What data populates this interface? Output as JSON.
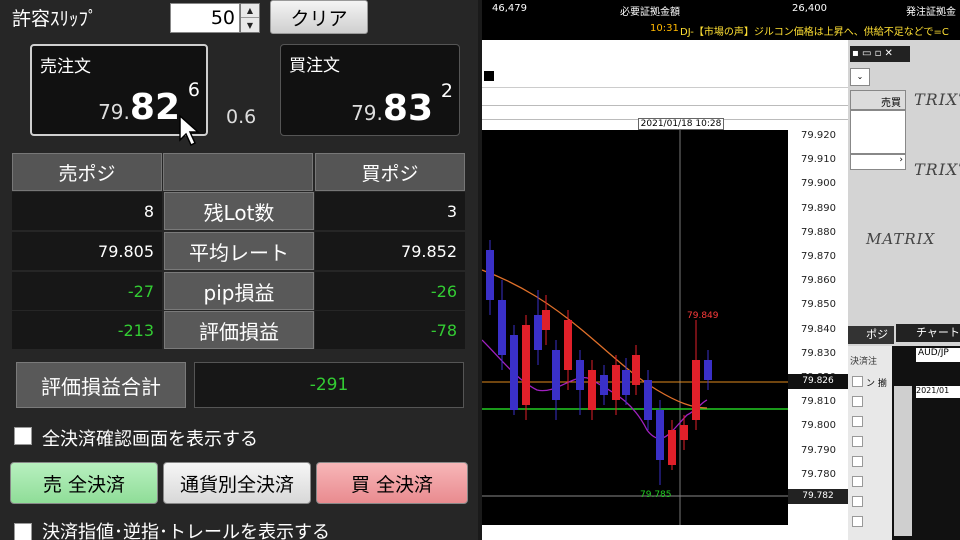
{
  "slippage": {
    "label": "許容ｽﾘｯﾌﾟ",
    "value": "50",
    "clear_label": "クリア"
  },
  "sell_box": {
    "title": "売注文",
    "price_small": "79.",
    "price_big": "82",
    "price_sup": "6"
  },
  "spread": "0.6",
  "buy_box": {
    "title": "買注文",
    "price_small": "79.",
    "price_big": "83",
    "price_sup": "2"
  },
  "position_table": {
    "sell_header": "売ポジ",
    "buy_header": "買ポジ",
    "rows": [
      {
        "label": "残Lot数",
        "sell": "8",
        "buy": "3"
      },
      {
        "label": "平均レート",
        "sell": "79.805",
        "buy": "79.852"
      },
      {
        "label": "pip損益",
        "sell": "-27",
        "buy": "-26"
      },
      {
        "label": "評価損益",
        "sell": "-213",
        "buy": "-78"
      }
    ]
  },
  "total_pl": {
    "label": "評価損益合計",
    "value": "-291"
  },
  "confirm_checkbox_label": "全決済確認画面を表示する",
  "buttons": {
    "sell_all": "売 全決済",
    "currency_all": "通貨別全決済",
    "buy_all": "買 全決済"
  },
  "limit_checkbox_label": "決済指値･逆指･トレールを表示する",
  "ticker": {
    "value1": "46,479",
    "label2": "必要証拠金額",
    "value2": "26,400",
    "label3": "発注証拠金"
  },
  "news": {
    "time": "10:31",
    "text": "DJ-【市場の声】ジルコン価格は上昇へ、供給不足などで=C"
  },
  "chart": {
    "timestamp": "2021/01/18 10:28",
    "price_labels": [
      "79.920",
      "79.910",
      "79.900",
      "79.890",
      "79.880",
      "79.870",
      "79.860",
      "79.850",
      "79.840",
      "79.830",
      "79.820",
      "79.810",
      "79.800",
      "79.790",
      "79.780"
    ],
    "current_price": "79.826",
    "low_line_price": "79.782",
    "high_annot": "79.849",
    "low_annot": "79.785"
  },
  "right_panel": {
    "sell_buy_col": "売買",
    "brand": "MATRIX",
    "brand_alt": "TRIXT",
    "tab_position": "ポジ",
    "tab_chart": "チャート",
    "settle_label": "決済注",
    "row_label": "ン 揃",
    "pair": "AUD/JP",
    "date_fragment": "2021/01"
  }
}
